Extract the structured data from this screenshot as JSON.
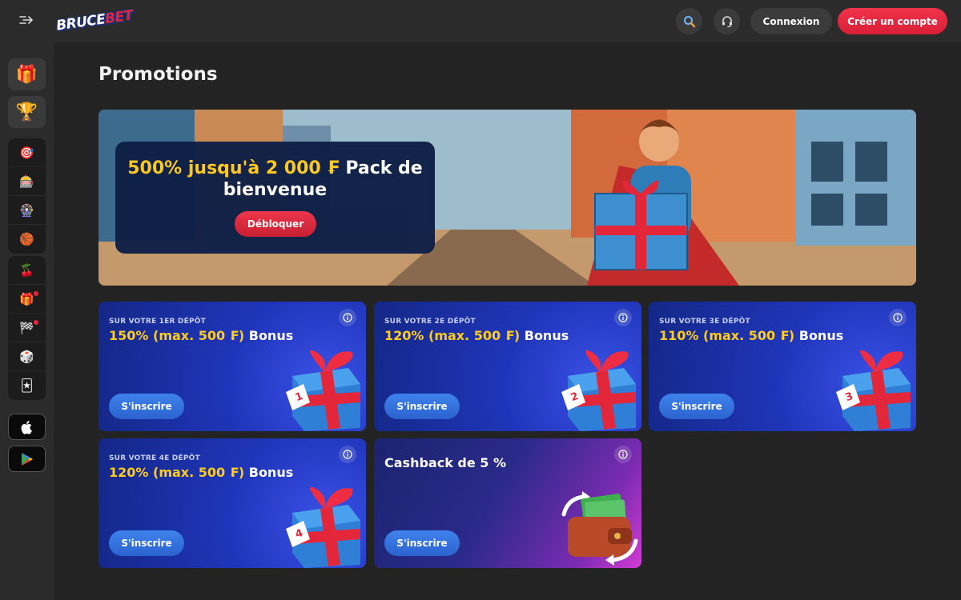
{
  "header": {
    "logo_part1": "BRUCE",
    "logo_part2": "BET",
    "login_label": "Connexion",
    "register_label": "Créer un compte"
  },
  "sidebar": {
    "top_items": [
      {
        "icon": "gift-icon",
        "glyph": "🎁"
      },
      {
        "icon": "trophy-icon",
        "glyph": "🏆"
      }
    ],
    "game_items": [
      {
        "icon": "target-icon",
        "glyph": "🎯"
      },
      {
        "icon": "slot-machine-icon",
        "glyph": "🎰"
      },
      {
        "icon": "roulette-icon",
        "glyph": "🎡"
      },
      {
        "icon": "ball-icon",
        "glyph": "🏀"
      }
    ],
    "category_items": [
      {
        "icon": "cherry-icon",
        "glyph": "🍒",
        "badge": false
      },
      {
        "icon": "present-icon",
        "glyph": "🎁",
        "badge": true
      },
      {
        "icon": "race-icon",
        "glyph": "🏁",
        "badge": true
      },
      {
        "icon": "dice-icon",
        "glyph": "🎲",
        "badge": false
      },
      {
        "icon": "cards-icon",
        "glyph": "🃏",
        "badge": false
      }
    ],
    "apps": [
      {
        "icon": "apple-icon"
      },
      {
        "icon": "google-play-icon"
      }
    ]
  },
  "page": {
    "title": "Promotions"
  },
  "hero": {
    "title_highlight": "500% jusqu'à 2 000 ₣",
    "title_rest": " Pack de",
    "title_line2": "bienvenue",
    "button_label": "Débloquer"
  },
  "promos": [
    {
      "subtitle": "SUR VOTRE 1ER DÉPÔT",
      "highlight": "150% (max. 500 ₣)",
      "rest": " Bonus",
      "button": "S'inscrire",
      "number": "1"
    },
    {
      "subtitle": "SUR VOTRE 2E DÉPÔT",
      "highlight": "120% (max. 500 ₣)",
      "rest": " Bonus",
      "button": "S'inscrire",
      "number": "2"
    },
    {
      "subtitle": "SUR VOTRE 3E DÉPÔT",
      "highlight": "110% (max. 500 ₣)",
      "rest": " Bonus",
      "button": "S'inscrire",
      "number": "3"
    },
    {
      "subtitle": "SUR VOTRE 4E DÉPÔT",
      "highlight": "120% (max. 500 ₣)",
      "rest": " Bonus",
      "button": "S'inscrire",
      "number": "4"
    }
  ],
  "cashback": {
    "title": "Cashback de 5 %",
    "button": "S'inscrire"
  },
  "colors": {
    "accent_red": "#e8223c",
    "highlight_yellow": "#ffcb1f",
    "button_blue": "#3a78e4",
    "background": "#232323"
  }
}
